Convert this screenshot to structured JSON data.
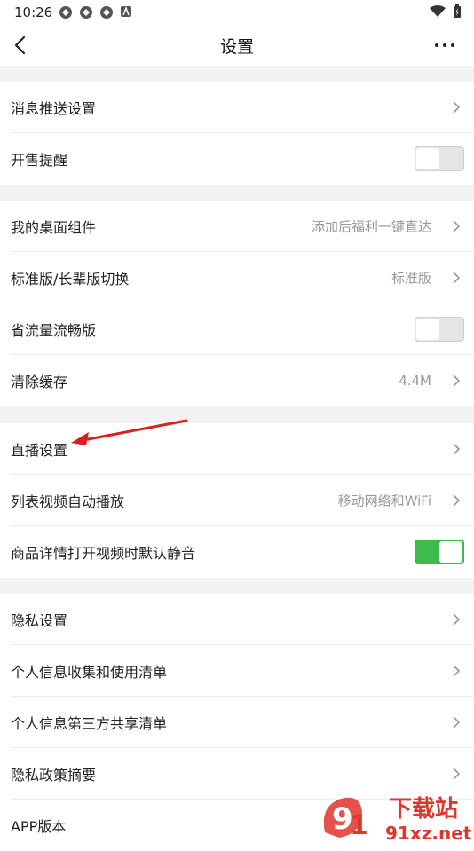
{
  "status_bar": {
    "time": "10:26"
  },
  "nav": {
    "title": "设置"
  },
  "group1": {
    "push": "消息推送设置",
    "sale_reminder": "开售提醒"
  },
  "group2": {
    "widget": "我的桌面组件",
    "widget_value": "添加后福利一键直达",
    "edition": "标准版/长辈版切换",
    "edition_value": "标准版",
    "data_saver": "省流量流畅版",
    "cache": "清除缓存",
    "cache_value": "4.4M"
  },
  "group3": {
    "live": "直播设置",
    "autoplay": "列表视频自动播放",
    "autoplay_value": "移动网络和WiFi",
    "mute": "商品详情打开视频时默认静音"
  },
  "group4": {
    "privacy": "隐私设置",
    "info_list": "个人信息收集和使用清单",
    "third_party": "个人信息第三方共享清单",
    "policy": "隐私政策摘要",
    "version": "APP版本"
  },
  "toggles": {
    "sale_reminder_on": false,
    "data_saver_on": false,
    "mute_on": true
  },
  "colors": {
    "toggle_on": "#3dbb4f",
    "annotation_arrow": "#d9201c"
  },
  "watermark": {
    "brand": "下载站",
    "domain": "91xz.net"
  }
}
